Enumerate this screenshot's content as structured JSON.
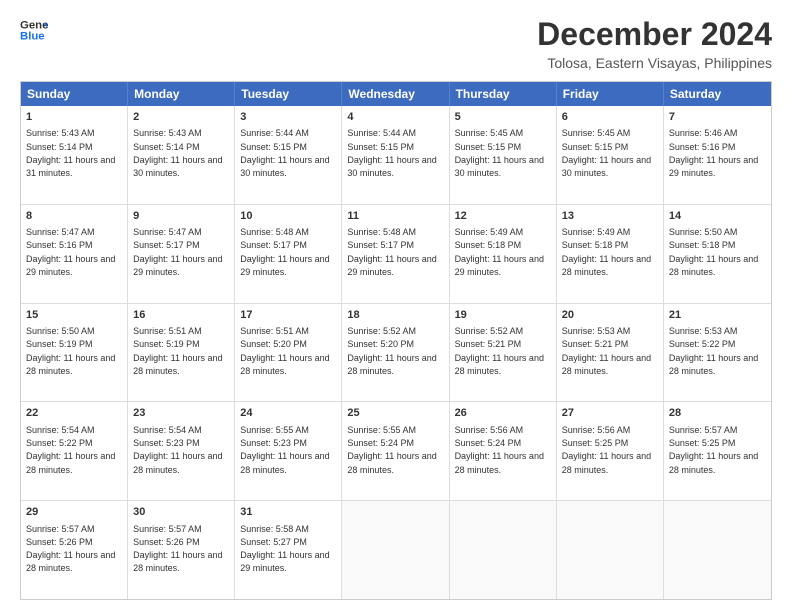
{
  "header": {
    "logo_line1": "General",
    "logo_line2": "Blue",
    "month_title": "December 2024",
    "location": "Tolosa, Eastern Visayas, Philippines"
  },
  "weekdays": [
    "Sunday",
    "Monday",
    "Tuesday",
    "Wednesday",
    "Thursday",
    "Friday",
    "Saturday"
  ],
  "rows": [
    [
      {
        "day": "1",
        "sunrise": "5:43 AM",
        "sunset": "5:14 PM",
        "daylight": "11 hours and 31 minutes."
      },
      {
        "day": "2",
        "sunrise": "5:43 AM",
        "sunset": "5:14 PM",
        "daylight": "11 hours and 30 minutes."
      },
      {
        "day": "3",
        "sunrise": "5:44 AM",
        "sunset": "5:15 PM",
        "daylight": "11 hours and 30 minutes."
      },
      {
        "day": "4",
        "sunrise": "5:44 AM",
        "sunset": "5:15 PM",
        "daylight": "11 hours and 30 minutes."
      },
      {
        "day": "5",
        "sunrise": "5:45 AM",
        "sunset": "5:15 PM",
        "daylight": "11 hours and 30 minutes."
      },
      {
        "day": "6",
        "sunrise": "5:45 AM",
        "sunset": "5:15 PM",
        "daylight": "11 hours and 30 minutes."
      },
      {
        "day": "7",
        "sunrise": "5:46 AM",
        "sunset": "5:16 PM",
        "daylight": "11 hours and 29 minutes."
      }
    ],
    [
      {
        "day": "8",
        "sunrise": "5:47 AM",
        "sunset": "5:16 PM",
        "daylight": "11 hours and 29 minutes."
      },
      {
        "day": "9",
        "sunrise": "5:47 AM",
        "sunset": "5:17 PM",
        "daylight": "11 hours and 29 minutes."
      },
      {
        "day": "10",
        "sunrise": "5:48 AM",
        "sunset": "5:17 PM",
        "daylight": "11 hours and 29 minutes."
      },
      {
        "day": "11",
        "sunrise": "5:48 AM",
        "sunset": "5:17 PM",
        "daylight": "11 hours and 29 minutes."
      },
      {
        "day": "12",
        "sunrise": "5:49 AM",
        "sunset": "5:18 PM",
        "daylight": "11 hours and 29 minutes."
      },
      {
        "day": "13",
        "sunrise": "5:49 AM",
        "sunset": "5:18 PM",
        "daylight": "11 hours and 28 minutes."
      },
      {
        "day": "14",
        "sunrise": "5:50 AM",
        "sunset": "5:18 PM",
        "daylight": "11 hours and 28 minutes."
      }
    ],
    [
      {
        "day": "15",
        "sunrise": "5:50 AM",
        "sunset": "5:19 PM",
        "daylight": "11 hours and 28 minutes."
      },
      {
        "day": "16",
        "sunrise": "5:51 AM",
        "sunset": "5:19 PM",
        "daylight": "11 hours and 28 minutes."
      },
      {
        "day": "17",
        "sunrise": "5:51 AM",
        "sunset": "5:20 PM",
        "daylight": "11 hours and 28 minutes."
      },
      {
        "day": "18",
        "sunrise": "5:52 AM",
        "sunset": "5:20 PM",
        "daylight": "11 hours and 28 minutes."
      },
      {
        "day": "19",
        "sunrise": "5:52 AM",
        "sunset": "5:21 PM",
        "daylight": "11 hours and 28 minutes."
      },
      {
        "day": "20",
        "sunrise": "5:53 AM",
        "sunset": "5:21 PM",
        "daylight": "11 hours and 28 minutes."
      },
      {
        "day": "21",
        "sunrise": "5:53 AM",
        "sunset": "5:22 PM",
        "daylight": "11 hours and 28 minutes."
      }
    ],
    [
      {
        "day": "22",
        "sunrise": "5:54 AM",
        "sunset": "5:22 PM",
        "daylight": "11 hours and 28 minutes."
      },
      {
        "day": "23",
        "sunrise": "5:54 AM",
        "sunset": "5:23 PM",
        "daylight": "11 hours and 28 minutes."
      },
      {
        "day": "24",
        "sunrise": "5:55 AM",
        "sunset": "5:23 PM",
        "daylight": "11 hours and 28 minutes."
      },
      {
        "day": "25",
        "sunrise": "5:55 AM",
        "sunset": "5:24 PM",
        "daylight": "11 hours and 28 minutes."
      },
      {
        "day": "26",
        "sunrise": "5:56 AM",
        "sunset": "5:24 PM",
        "daylight": "11 hours and 28 minutes."
      },
      {
        "day": "27",
        "sunrise": "5:56 AM",
        "sunset": "5:25 PM",
        "daylight": "11 hours and 28 minutes."
      },
      {
        "day": "28",
        "sunrise": "5:57 AM",
        "sunset": "5:25 PM",
        "daylight": "11 hours and 28 minutes."
      }
    ],
    [
      {
        "day": "29",
        "sunrise": "5:57 AM",
        "sunset": "5:26 PM",
        "daylight": "11 hours and 28 minutes."
      },
      {
        "day": "30",
        "sunrise": "5:57 AM",
        "sunset": "5:26 PM",
        "daylight": "11 hours and 28 minutes."
      },
      {
        "day": "31",
        "sunrise": "5:58 AM",
        "sunset": "5:27 PM",
        "daylight": "11 hours and 29 minutes."
      },
      null,
      null,
      null,
      null
    ]
  ]
}
